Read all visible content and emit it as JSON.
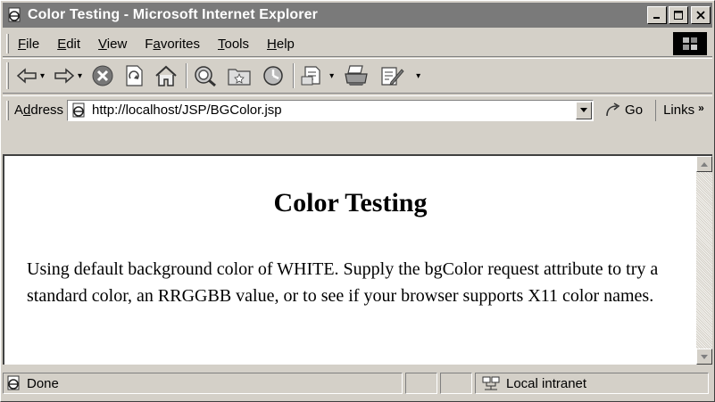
{
  "window": {
    "title": "Color Testing - Microsoft Internet Explorer"
  },
  "menu": {
    "items": [
      {
        "underline": "F",
        "rest": "ile"
      },
      {
        "underline": "E",
        "rest": "dit"
      },
      {
        "underline": "V",
        "rest": "iew"
      },
      {
        "pre": "F",
        "underline": "a",
        "rest": "vorites"
      },
      {
        "underline": "T",
        "rest": "ools"
      },
      {
        "underline": "H",
        "rest": "elp"
      }
    ]
  },
  "address": {
    "label_pre": "A",
    "label_underline": "d",
    "label_rest": "dress",
    "url": "http://localhost/JSP/BGColor.jsp",
    "go_label": "Go",
    "links_label": "Links"
  },
  "page": {
    "heading": "Color Testing",
    "body": "Using default background color of WHITE. Supply the bgColor request attribute to try a standard color, an RRGGBB value, or to see if your browser supports X11 color names."
  },
  "status": {
    "text": "Done",
    "zone": "Local intranet"
  },
  "icons": {
    "title": "ie-page-icon",
    "back": "back-arrow-icon",
    "forward": "forward-arrow-icon",
    "stop": "stop-icon",
    "refresh": "refresh-icon",
    "home": "home-icon",
    "search": "search-icon",
    "favorites": "favorites-icon",
    "history": "history-icon",
    "mail": "mail-icon",
    "print": "print-icon",
    "edit": "edit-icon"
  }
}
